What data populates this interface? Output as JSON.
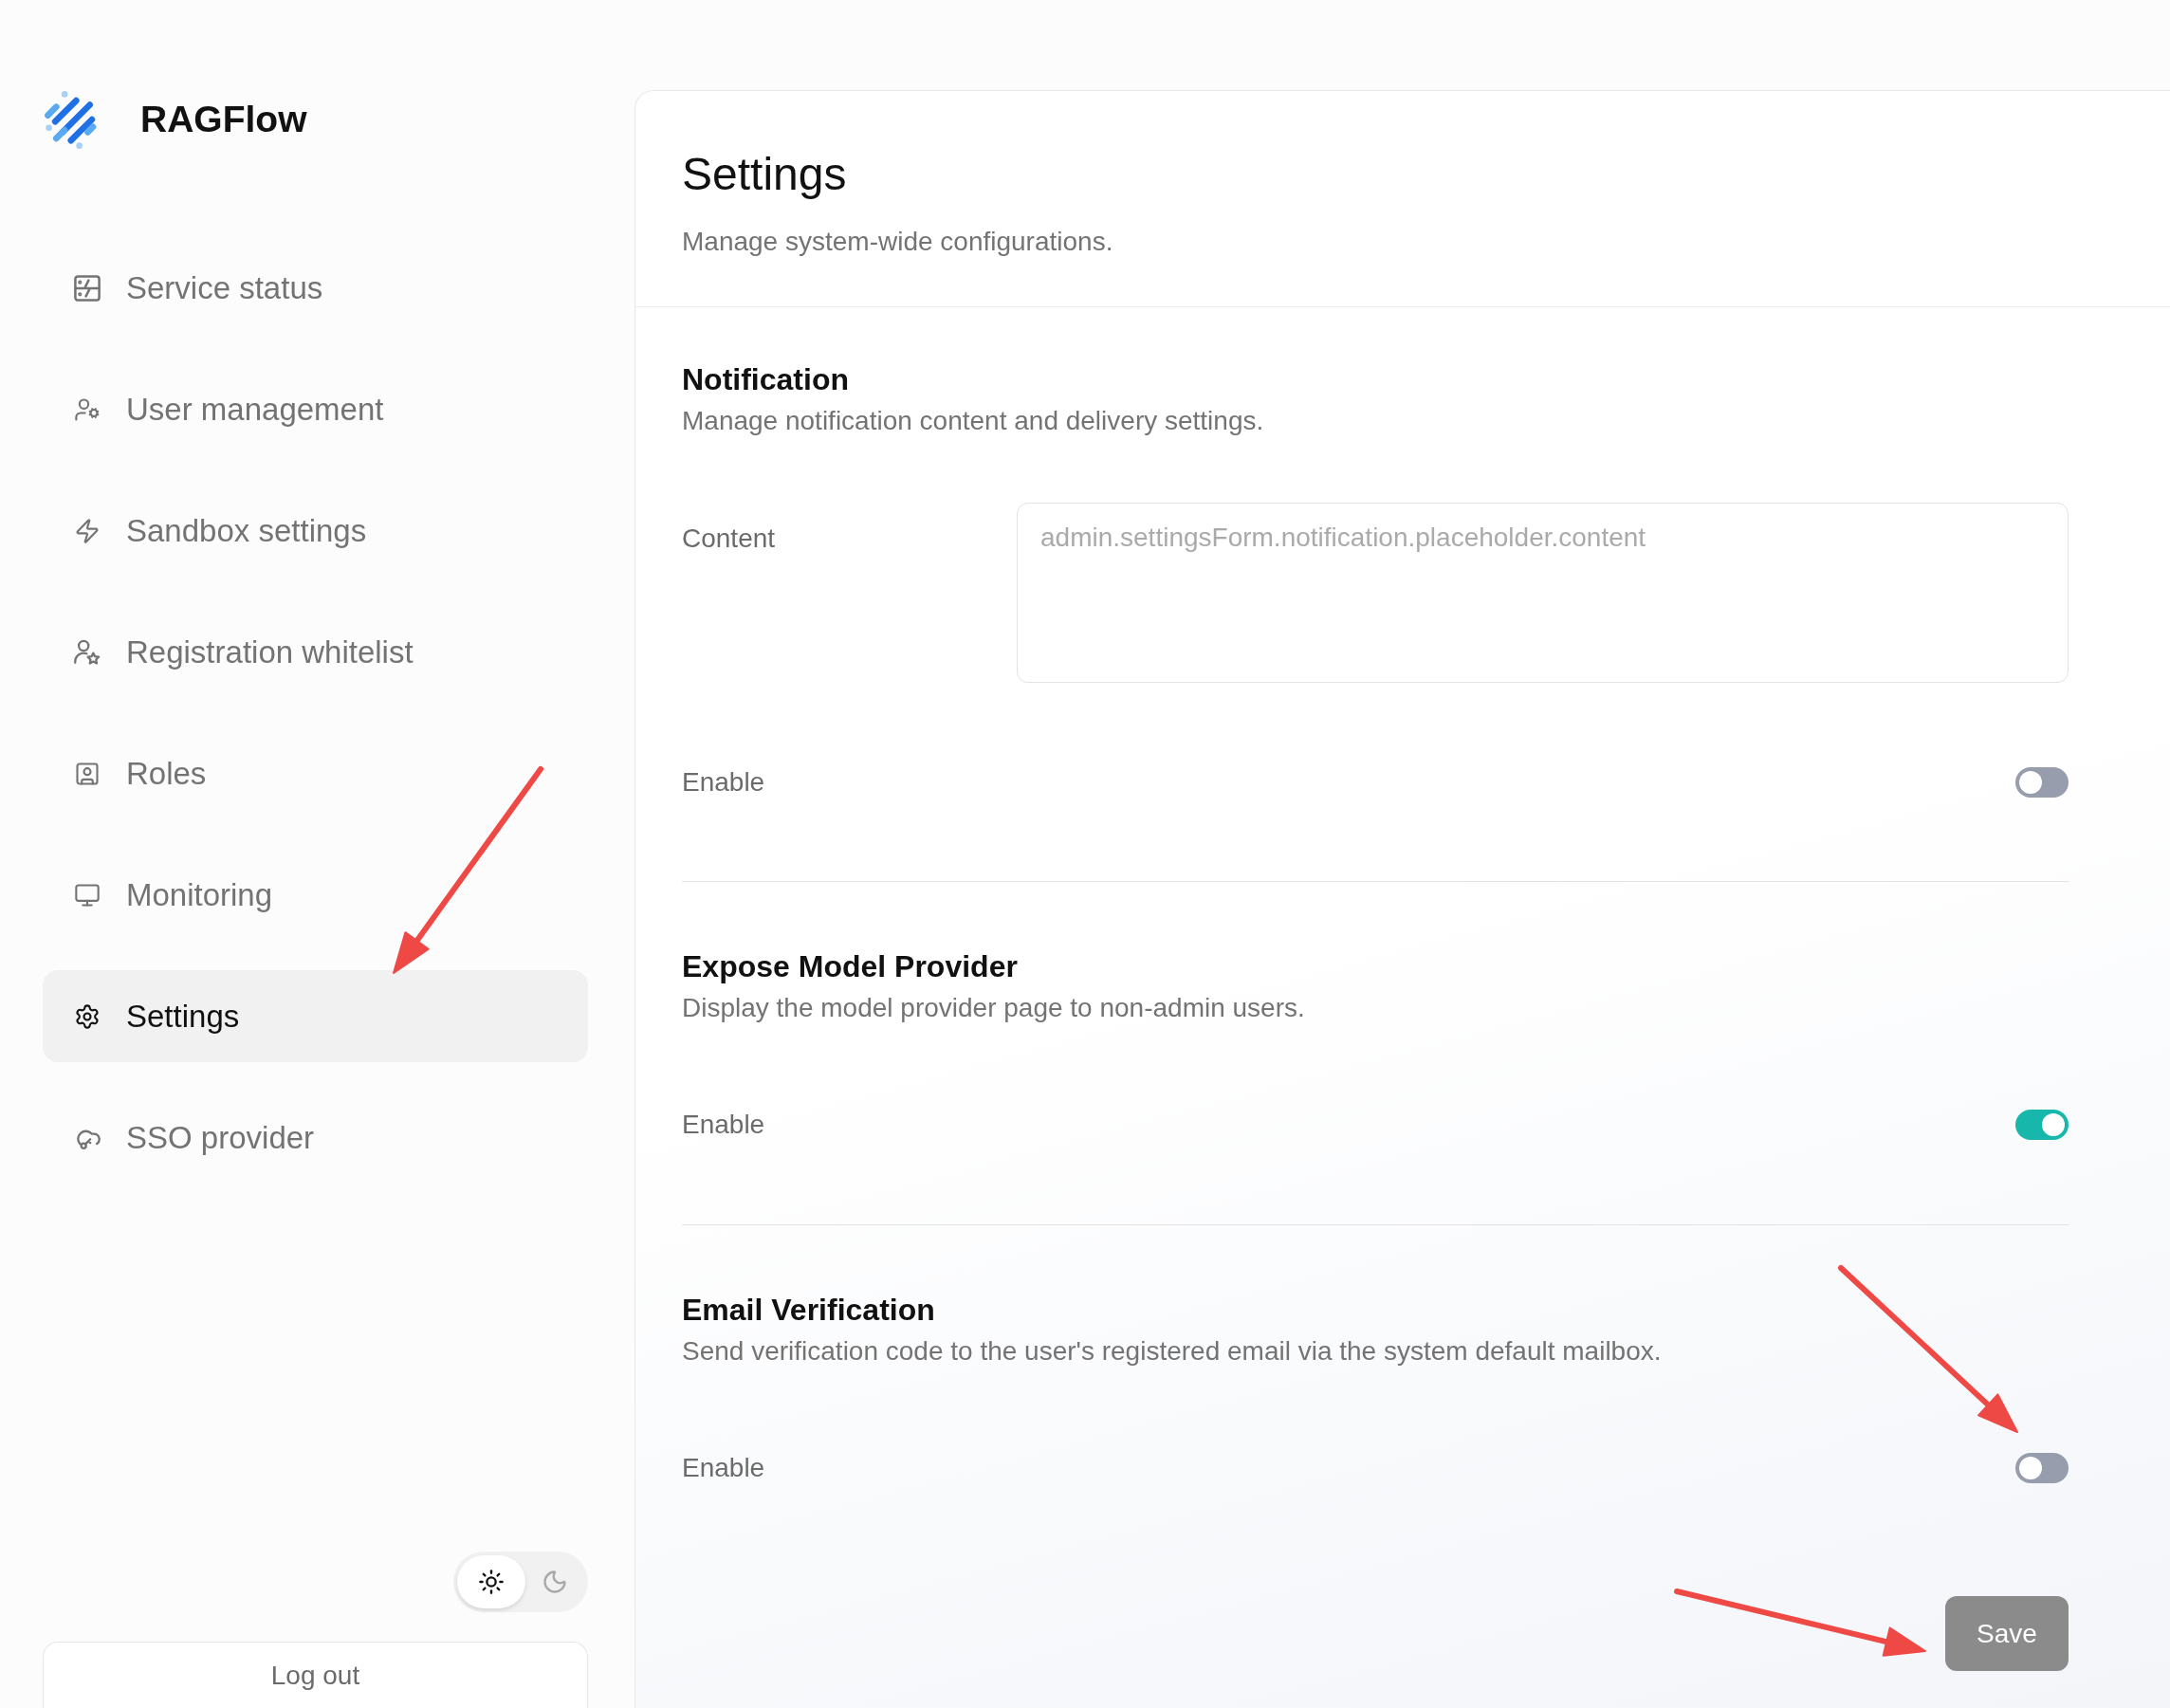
{
  "brand": {
    "name": "RAGFlow"
  },
  "sidebar": {
    "items": [
      {
        "label": "Service status",
        "selected": false
      },
      {
        "label": "User management",
        "selected": false
      },
      {
        "label": "Sandbox settings",
        "selected": false
      },
      {
        "label": "Registration whitelist",
        "selected": false
      },
      {
        "label": "Roles",
        "selected": false
      },
      {
        "label": "Monitoring",
        "selected": false
      },
      {
        "label": "Settings",
        "selected": true
      },
      {
        "label": "SSO provider",
        "selected": false
      }
    ],
    "theme_switch": [
      {
        "selected": true
      },
      {
        "selected": false
      }
    ],
    "logout_button": "Log out"
  },
  "page": {
    "title": "Settings",
    "subtitle": "Manage system-wide configurations."
  },
  "sections": [
    {
      "title": "Notification",
      "description": "Manage notification content and delivery settings.",
      "fields": [
        {
          "kind": "textarea",
          "label": "Content",
          "placeholder": "admin.settingsForm.notification.placeholder.content"
        },
        {
          "kind": "switch",
          "label": "Enable",
          "on": false
        }
      ]
    },
    {
      "title": "Expose Model Provider",
      "description": "Display the model provider page to non-admin users.",
      "fields": [
        {
          "kind": "switch",
          "label": "Enable",
          "on": true
        }
      ]
    },
    {
      "title": "Email Verification",
      "description": "Send verification code to the user's registered email via the system default mailbox.",
      "fields": [
        {
          "kind": "switch",
          "label": "Enable",
          "on": false
        }
      ]
    }
  ],
  "save_button": "Save"
}
